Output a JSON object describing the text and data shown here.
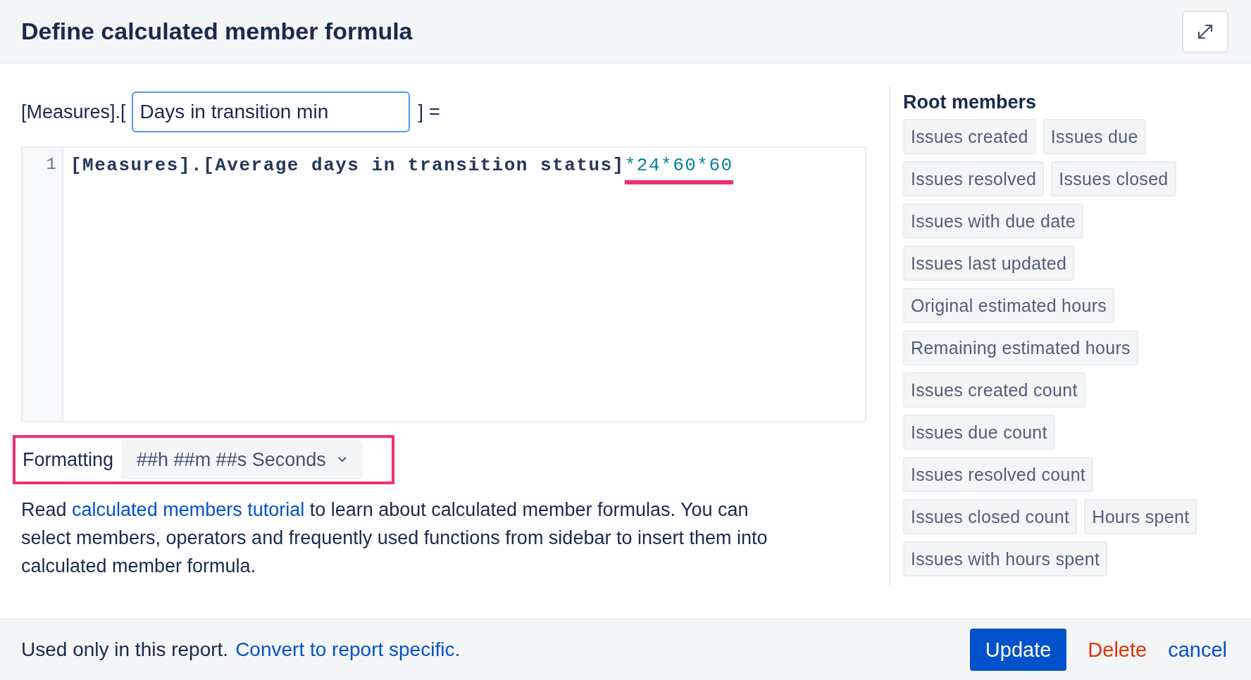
{
  "dialog": {
    "title": "Define calculated member formula"
  },
  "name_row": {
    "prefix": "[Measures].[",
    "value": "Days in transition min",
    "suffix": "]",
    "equals": "="
  },
  "editor": {
    "lines": [
      {
        "number": "1",
        "segments": [
          {
            "text": "[Measures].[Average days in transition status]",
            "kind": "member",
            "underlined": false
          },
          {
            "text": "*24*60*60",
            "kind": "number",
            "underlined": true
          }
        ]
      }
    ]
  },
  "formatting": {
    "label": "Formatting",
    "value": "##h ##m ##s Seconds",
    "highlighted": true
  },
  "help": {
    "before": "Read ",
    "link": "calculated members tutorial",
    "after": " to learn about calculated member formulas. You can select members, operators and frequently used functions from sidebar to insert them into calculated member formula."
  },
  "sidebar": {
    "title": "Root members",
    "members": [
      "Issues created",
      "Issues due",
      "Issues resolved",
      "Issues closed",
      "Issues with due date",
      "Issues last updated",
      "Original estimated hours",
      "Remaining estimated hours",
      "Issues created count",
      "Issues due count",
      "Issues resolved count",
      "Issues closed count",
      "Hours spent",
      "Issues with hours spent"
    ]
  },
  "footer": {
    "note": "Used only in this report.",
    "link": "Convert to report specific.",
    "buttons": [
      {
        "label": "Update",
        "kind": "primary"
      },
      {
        "label": "Delete",
        "kind": "danger"
      },
      {
        "label": "cancel",
        "kind": "link"
      }
    ]
  }
}
